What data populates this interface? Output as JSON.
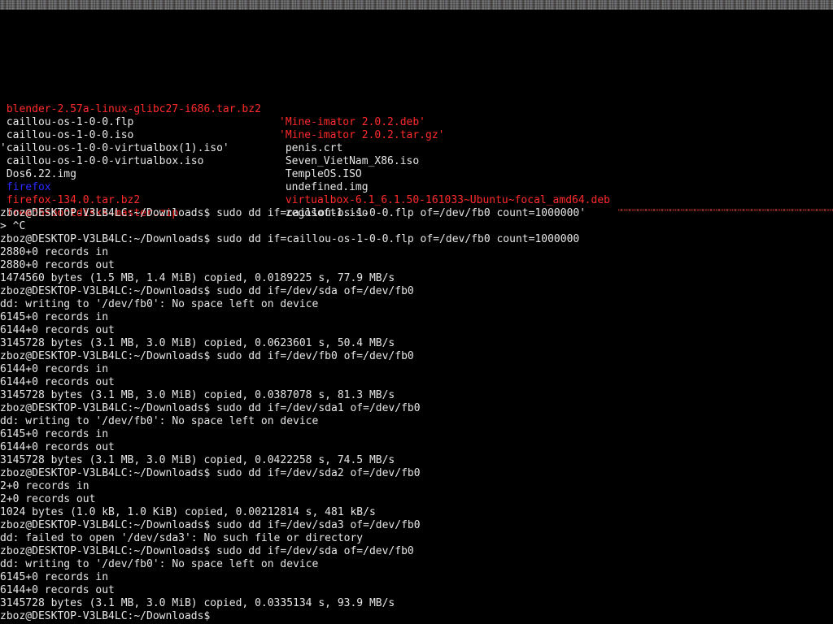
{
  "terminal": {
    "listing": [
      {
        "left": {
          "text": " blender-2.57a-linux-glibc27-i686.tar.bz2",
          "color": "red"
        },
        "right": {
          "text": "'Mine-imator 2.0.2.deb'",
          "color": "red"
        }
      },
      {
        "left": {
          "text": " caillou-os-1-0-0.flp",
          "color": "white"
        },
        "right": {
          "text": "'Mine-imator 2.0.2.tar.gz'",
          "color": "red"
        }
      },
      {
        "left": {
          "text": " caillou-os-1-0-0.iso",
          "color": "white"
        },
        "right": {
          "text": " penis.crt",
          "color": "white"
        }
      },
      {
        "left": {
          "text": "'caillou-os-1-0-0-virtualbox(1).iso'",
          "color": "white"
        },
        "right": {
          "text": " Seven_VietNam_X86.iso",
          "color": "white"
        }
      },
      {
        "left": {
          "text": " caillou-os-1-0-0-virtualbox.iso",
          "color": "white"
        },
        "right": {
          "text": " TempleOS.ISO",
          "color": "white"
        }
      },
      {
        "left": {
          "text": " Dos6.22.img",
          "color": "white"
        },
        "right": {
          "text": " undefined.img",
          "color": "white"
        }
      },
      {
        "left": {
          "text": " firefox",
          "color": "blue"
        },
        "right": {
          "text": " virtualbox-6.1_6.1.50-161033~Ubuntu~focal_amd64.deb",
          "color": "red"
        }
      },
      {
        "left": {
          "text": " firefox-134.0.tar.bz2",
          "color": "red"
        },
        "right": {
          "text": " zegosoft1.iso",
          "color": "white"
        }
      },
      {
        "left": {
          "text": " freedosbootdisks-master.zip",
          "color": "red"
        },
        "right": {
          "text": "",
          "color": "white"
        }
      }
    ],
    "log_lines": [
      "zboz@DESKTOP-V3LB4LC:~/Downloads$ sudo dd if=caillou-os-1-0-0.flp of=/dev/fb0 count=1000000'",
      "> ^C",
      "zboz@DESKTOP-V3LB4LC:~/Downloads$ sudo dd if=caillou-os-1-0-0.flp of=/dev/fb0 count=1000000",
      "2880+0 records in",
      "2880+0 records out",
      "1474560 bytes (1.5 MB, 1.4 MiB) copied, 0.0189225 s, 77.9 MB/s",
      "zboz@DESKTOP-V3LB4LC:~/Downloads$ sudo dd if=/dev/sda of=/dev/fb0",
      "dd: writing to '/dev/fb0': No space left on device",
      "6145+0 records in",
      "6144+0 records out",
      "3145728 bytes (3.1 MB, 3.0 MiB) copied, 0.0623601 s, 50.4 MB/s",
      "zboz@DESKTOP-V3LB4LC:~/Downloads$ sudo dd if=/dev/fb0 of=/dev/fb0",
      "6144+0 records in",
      "6144+0 records out",
      "3145728 bytes (3.1 MB, 3.0 MiB) copied, 0.0387078 s, 81.3 MB/s",
      "zboz@DESKTOP-V3LB4LC:~/Downloads$ sudo dd if=/dev/sda1 of=/dev/fb0",
      "dd: writing to '/dev/fb0': No space left on device",
      "6145+0 records in",
      "6144+0 records out",
      "3145728 bytes (3.1 MB, 3.0 MiB) copied, 0.0422258 s, 74.5 MB/s",
      "zboz@DESKTOP-V3LB4LC:~/Downloads$ sudo dd if=/dev/sda2 of=/dev/fb0",
      "2+0 records in",
      "2+0 records out",
      "1024 bytes (1.0 kB, 1.0 KiB) copied, 0.00212814 s, 481 kB/s",
      "zboz@DESKTOP-V3LB4LC:~/Downloads$ sudo dd if=/dev/sda3 of=/dev/fb0",
      "dd: failed to open '/dev/sda3': No such file or directory",
      "zboz@DESKTOP-V3LB4LC:~/Downloads$ sudo dd if=/dev/sda of=/dev/fb0",
      "dd: writing to '/dev/fb0': No space left on device",
      "6145+0 records in",
      "6144+0 records out",
      "3145728 bytes (3.1 MB, 3.0 MiB) copied, 0.0335134 s, 93.9 MB/s",
      "zboz@DESKTOP-V3LB4LC:~/Downloads$"
    ]
  },
  "colors": {
    "background": "#000000",
    "text": "#e6e6e6",
    "archive_red": "#ff2a2a",
    "directory_blue": "#2a2aff"
  }
}
